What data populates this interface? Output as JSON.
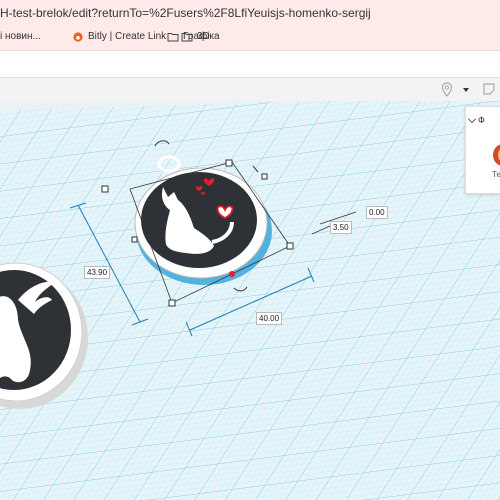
{
  "browser": {
    "url": "H-test-brelok/edit?returnTo=%2Fusers%2F8LfiYeuisjs-homenko-sergij"
  },
  "bookmarks": [
    {
      "label": "і новин...",
      "icon": "folder-icon"
    },
    {
      "label": "Bitly | Create Link",
      "icon": "bitly-icon"
    },
    {
      "label": "Графіка",
      "icon": "folder-icon"
    },
    {
      "label": "3D",
      "icon": "folder-icon"
    }
  ],
  "panel": {
    "title": "Ф",
    "caption": "Те"
  },
  "dimensions": {
    "depth": "43.90",
    "width": "40.00",
    "height": "3.50",
    "elevation": "0.00"
  },
  "colors": {
    "grid": "#bfe3ee",
    "grid_major": "#7fc6dd",
    "selection": "#3aa6d8",
    "handle": "#333333",
    "body_dark": "#2e3236",
    "rim": "#ffffff",
    "heart": "#e0202a"
  }
}
